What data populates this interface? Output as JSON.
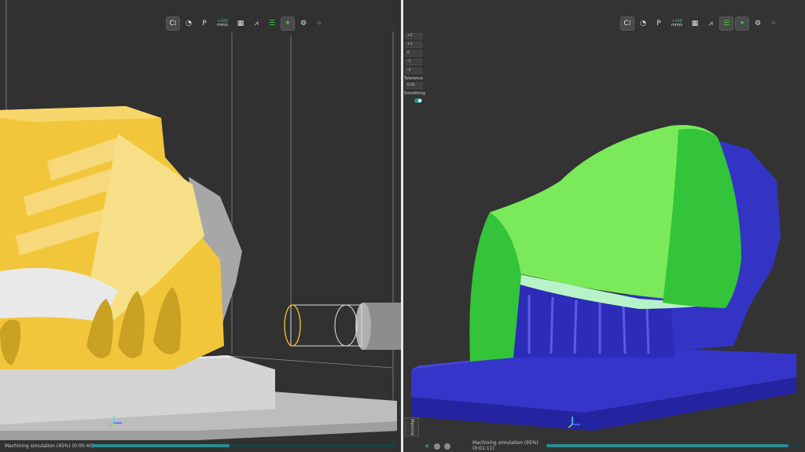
{
  "left_view": {
    "toolbar": {
      "items": [
        {
          "icon": "display-mode-icon",
          "glyph": "C⁞",
          "active": true
        },
        {
          "icon": "camera-icon",
          "glyph": "◔"
        },
        {
          "icon": "parking-icon",
          "glyph": "P"
        },
        {
          "icon": "feed-rate-icon",
          "top": "+100",
          "bottom": "mm/s"
        },
        {
          "icon": "stock-icon",
          "glyph": "▦"
        },
        {
          "icon": "toolpath-icon",
          "glyph": "⩘"
        },
        {
          "icon": "layers-icon",
          "glyph": "☰"
        },
        {
          "icon": "tool-visibility-icon",
          "glyph": "✦",
          "active": true
        },
        {
          "icon": "settings-gear-icon",
          "glyph": "⚙"
        },
        {
          "icon": "grid-icon",
          "glyph": "⁘"
        }
      ]
    },
    "status": {
      "text": "Machining simulation (45%) (0:00:40)",
      "progress": 0.45
    }
  },
  "right_view": {
    "toolbar": {
      "items": [
        {
          "icon": "display-mode-icon",
          "glyph": "C⁞",
          "active": true
        },
        {
          "icon": "camera-icon",
          "glyph": "◔"
        },
        {
          "icon": "parking-icon",
          "glyph": "P"
        },
        {
          "icon": "feed-rate-icon",
          "top": "+100",
          "bottom": "mm/s"
        },
        {
          "icon": "stock-icon",
          "glyph": "▦"
        },
        {
          "icon": "toolpath-icon",
          "glyph": "⩘"
        },
        {
          "icon": "layers-icon",
          "glyph": "☰",
          "active": true
        },
        {
          "icon": "comparison-icon",
          "glyph": "✦",
          "active": true
        },
        {
          "icon": "settings-gear-icon",
          "glyph": "⚙"
        },
        {
          "icon": "grid-icon",
          "glyph": "⁘"
        }
      ]
    },
    "params": {
      "rows": [
        "+2",
        "+1",
        "0",
        "-1",
        "-2"
      ],
      "tolerance_label": "Tolerance",
      "tolerance_value": "0.01",
      "smoothing_label": "Smoothing"
    },
    "side_button": "Machine",
    "status": {
      "text": "Machining simulation (95%) (0:01:11)",
      "progress": 0.95
    }
  },
  "colors": {
    "stock_yellow": "#f2c63a",
    "stock_yellow_light": "#f6df86",
    "table_gray": "#c9c9c9",
    "compare_green": "#35c43a",
    "compare_blue": "#2f2fc8",
    "progress_teal": "#2a8d90"
  }
}
